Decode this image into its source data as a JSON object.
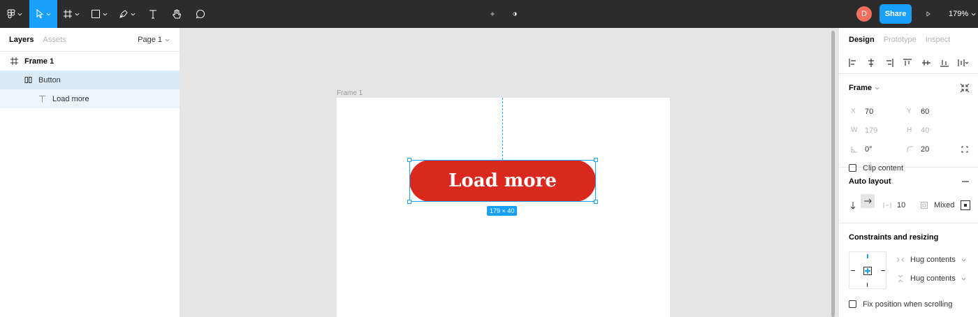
{
  "toolbar": {
    "avatar_initial": "D",
    "share_label": "Share",
    "zoom_label": "179%",
    "accent": "#18a0fb"
  },
  "left_panel": {
    "tabs": [
      {
        "label": "Layers",
        "active": true
      },
      {
        "label": "Assets",
        "active": false
      }
    ],
    "page_label": "Page 1",
    "layers": [
      {
        "name": "Frame 1",
        "icon": "frame-icon"
      },
      {
        "name": "Button",
        "icon": "auto-layout-icon"
      },
      {
        "name": "Load more",
        "icon": "text-icon"
      }
    ]
  },
  "canvas": {
    "frame_label": "Frame 1",
    "button_text": "Load more",
    "button_color": "#d9291f",
    "size_badge": "179 × 40"
  },
  "right_panel": {
    "tabs": [
      {
        "label": "Design",
        "active": true
      },
      {
        "label": "Prototype",
        "active": false
      },
      {
        "label": "Inspect",
        "active": false
      }
    ],
    "frame_section": {
      "title": "Frame",
      "x_label": "X",
      "x_value": "70",
      "y_label": "Y",
      "y_value": "60",
      "w_label": "W",
      "w_value": "179",
      "h_label": "H",
      "h_value": "40",
      "rotation_value": "0°",
      "radius_value": "20",
      "clip_label": "Clip content"
    },
    "auto_layout": {
      "title": "Auto layout",
      "spacing_value": "10",
      "padding_value": "Mixed"
    },
    "constraints": {
      "title": "Constraints and resizing",
      "horizontal_label": "Hug contents",
      "vertical_label": "Hug contents",
      "fix_label": "Fix position when scrolling"
    }
  }
}
